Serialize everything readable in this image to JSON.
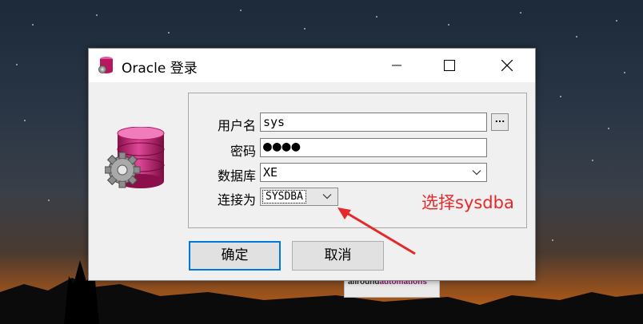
{
  "window": {
    "title": "Oracle 登录"
  },
  "form": {
    "username_label": "用户名",
    "username_value": "sys",
    "username_browse": "...",
    "password_label": "密码",
    "password_value": "●●●●",
    "database_label": "数据库",
    "database_value": "XE",
    "connect_as_label": "连接为",
    "connect_as_value": "SYSDBA"
  },
  "buttons": {
    "ok": "确定",
    "cancel": "取消"
  },
  "annotation": {
    "text": "选择sysdba",
    "color": "#e5282a"
  },
  "background_window": {
    "brand_prefix": "allround",
    "brand_accent": "automations"
  },
  "colors": {
    "focus_border": "#0078d7",
    "db_icon": "#c2186b"
  },
  "icons": [
    "database-gear-icon",
    "minimize-icon",
    "maximize-icon",
    "close-icon",
    "chevron-down-icon",
    "red-arrow-icon"
  ]
}
